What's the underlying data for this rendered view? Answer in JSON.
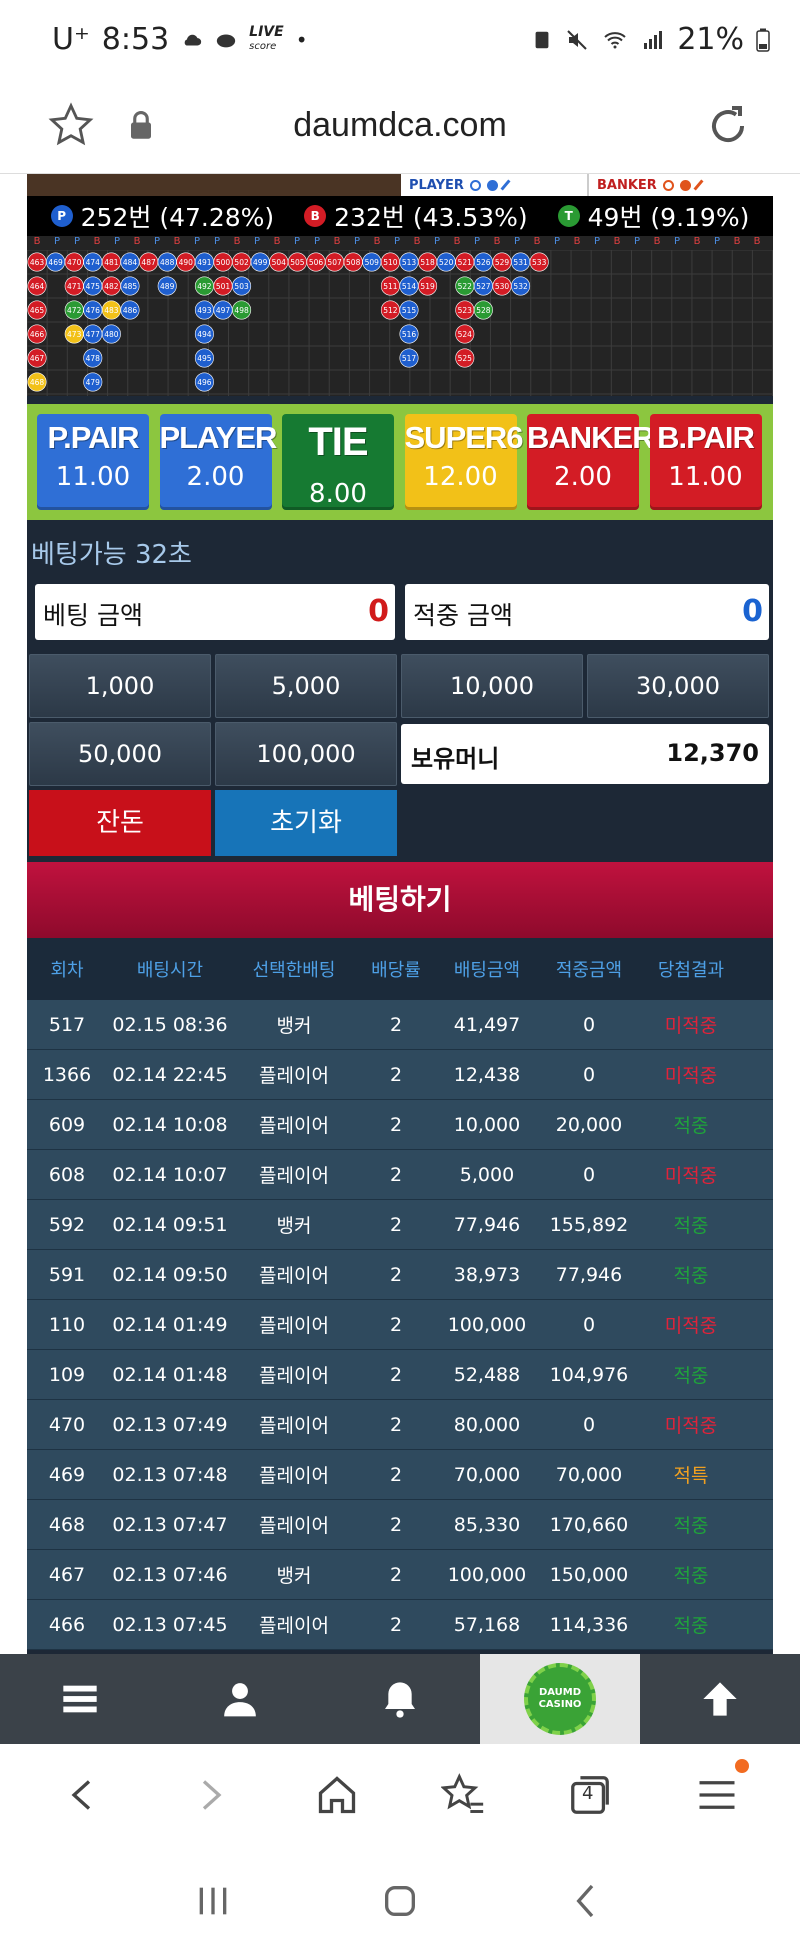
{
  "status_bar": {
    "carrier": "U⁺",
    "time": "8:53",
    "live_logo": "LIVE",
    "live_sub": "score",
    "battery": "21%"
  },
  "browser": {
    "url": "daumdca.com"
  },
  "legend": {
    "player": "PLAYER",
    "banker": "BANKER"
  },
  "stats": {
    "player_badge": "P",
    "player": "252번 (47.28%)",
    "banker_badge": "B",
    "banker": "232번 (43.53%)",
    "tie_badge": "T",
    "tie": "49번 (9.19%)"
  },
  "road": {
    "header_letters": [
      "B",
      "P",
      "P",
      "B",
      "P",
      "B",
      "P",
      "B",
      "P",
      "P",
      "B",
      "P",
      "B",
      "P",
      "P",
      "B",
      "P",
      "B",
      "P",
      "B",
      "P",
      "B",
      "P",
      "B",
      "P",
      "B",
      "P",
      "B",
      "P",
      "B",
      "P",
      "B",
      "P",
      "B",
      "P",
      "B",
      "B"
    ],
    "columns": [
      [
        "463",
        "464",
        "465",
        "466",
        "467",
        "468"
      ],
      [
        "469"
      ],
      [
        "470",
        "471",
        "472",
        "473"
      ],
      [
        "474",
        "475",
        "476",
        "477",
        "478",
        "479"
      ],
      [
        "481",
        "482",
        "483",
        "480"
      ],
      [
        "484",
        "485",
        "486"
      ],
      [
        "487"
      ],
      [
        "488",
        "489"
      ],
      [
        "490"
      ],
      [
        "491",
        "492",
        "493",
        "494",
        "495",
        "496"
      ],
      [
        "500",
        "501",
        "497"
      ],
      [
        "502",
        "503",
        "498"
      ],
      [
        "499"
      ],
      [
        "504"
      ],
      [
        "505"
      ],
      [
        "506"
      ],
      [
        "507"
      ],
      [
        "508"
      ],
      [
        "509"
      ],
      [
        "510",
        "511",
        "512"
      ],
      [
        "513",
        "514",
        "515",
        "516",
        "517"
      ],
      [
        "518",
        "519"
      ],
      [
        "520"
      ],
      [
        "521",
        "522",
        "523",
        "524",
        "525"
      ],
      [
        "526",
        "527",
        "528"
      ],
      [
        "529",
        "530"
      ],
      [
        "531",
        "532"
      ],
      [
        "533"
      ]
    ]
  },
  "bets": [
    {
      "label": "P.PAIR",
      "odds": "11.00",
      "color": "#2f6fd6"
    },
    {
      "label": "PLAYER",
      "odds": "2.00",
      "color": "#2f6fd6"
    },
    {
      "label": "TIE",
      "odds": "8.00",
      "color": "#167a32"
    },
    {
      "label": "SUPER6",
      "odds": "12.00",
      "color": "#f2c118"
    },
    {
      "label": "BANKER",
      "odds": "2.00",
      "color": "#d31c25"
    },
    {
      "label": "B.PAIR",
      "odds": "11.00",
      "color": "#d31c25"
    }
  ],
  "timer": "베팅가능 32초",
  "bet_amount": {
    "label": "베팅 금액",
    "value": "0",
    "color": "#d11a1a"
  },
  "win_amount": {
    "label": "적중 금액",
    "value": "0",
    "color": "#1a63d1"
  },
  "chips": [
    "1,000",
    "5,000",
    "10,000",
    "30,000",
    "50,000",
    "100,000"
  ],
  "balance": {
    "label": "보유머니",
    "value": "12,370"
  },
  "actions": {
    "change": "잔돈",
    "reset": "초기화",
    "place": "베팅하기"
  },
  "table": {
    "headers": [
      "회차",
      "배팅시간",
      "선택한배팅",
      "배당률",
      "배팅금액",
      "적중금액",
      "당첨결과"
    ],
    "rows": [
      [
        "517",
        "02.15 08:36",
        "뱅커",
        "2",
        "41,497",
        "0",
        "미적중",
        "loss"
      ],
      [
        "1366",
        "02.14 22:45",
        "플레이어",
        "2",
        "12,438",
        "0",
        "미적중",
        "loss"
      ],
      [
        "609",
        "02.14 10:08",
        "플레이어",
        "2",
        "10,000",
        "20,000",
        "적중",
        "win"
      ],
      [
        "608",
        "02.14 10:07",
        "플레이어",
        "2",
        "5,000",
        "0",
        "미적중",
        "loss"
      ],
      [
        "592",
        "02.14 09:51",
        "뱅커",
        "2",
        "77,946",
        "155,892",
        "적중",
        "win"
      ],
      [
        "591",
        "02.14 09:50",
        "플레이어",
        "2",
        "38,973",
        "77,946",
        "적중",
        "win"
      ],
      [
        "110",
        "02.14 01:49",
        "플레이어",
        "2",
        "100,000",
        "0",
        "미적중",
        "loss"
      ],
      [
        "109",
        "02.14 01:48",
        "플레이어",
        "2",
        "52,488",
        "104,976",
        "적중",
        "win"
      ],
      [
        "470",
        "02.13 07:49",
        "플레이어",
        "2",
        "80,000",
        "0",
        "미적중",
        "loss"
      ],
      [
        "469",
        "02.13 07:48",
        "플레이어",
        "2",
        "70,000",
        "70,000",
        "적특",
        "tie"
      ],
      [
        "468",
        "02.13 07:47",
        "플레이어",
        "2",
        "85,330",
        "170,660",
        "적중",
        "win"
      ],
      [
        "467",
        "02.13 07:46",
        "뱅커",
        "2",
        "100,000",
        "150,000",
        "적중",
        "win"
      ],
      [
        "466",
        "02.13 07:45",
        "플레이어",
        "2",
        "57,168",
        "114,336",
        "적중",
        "win"
      ]
    ]
  },
  "site_nav": {
    "logo_text": "DAUMD CASINO"
  },
  "tabs_count": "4"
}
